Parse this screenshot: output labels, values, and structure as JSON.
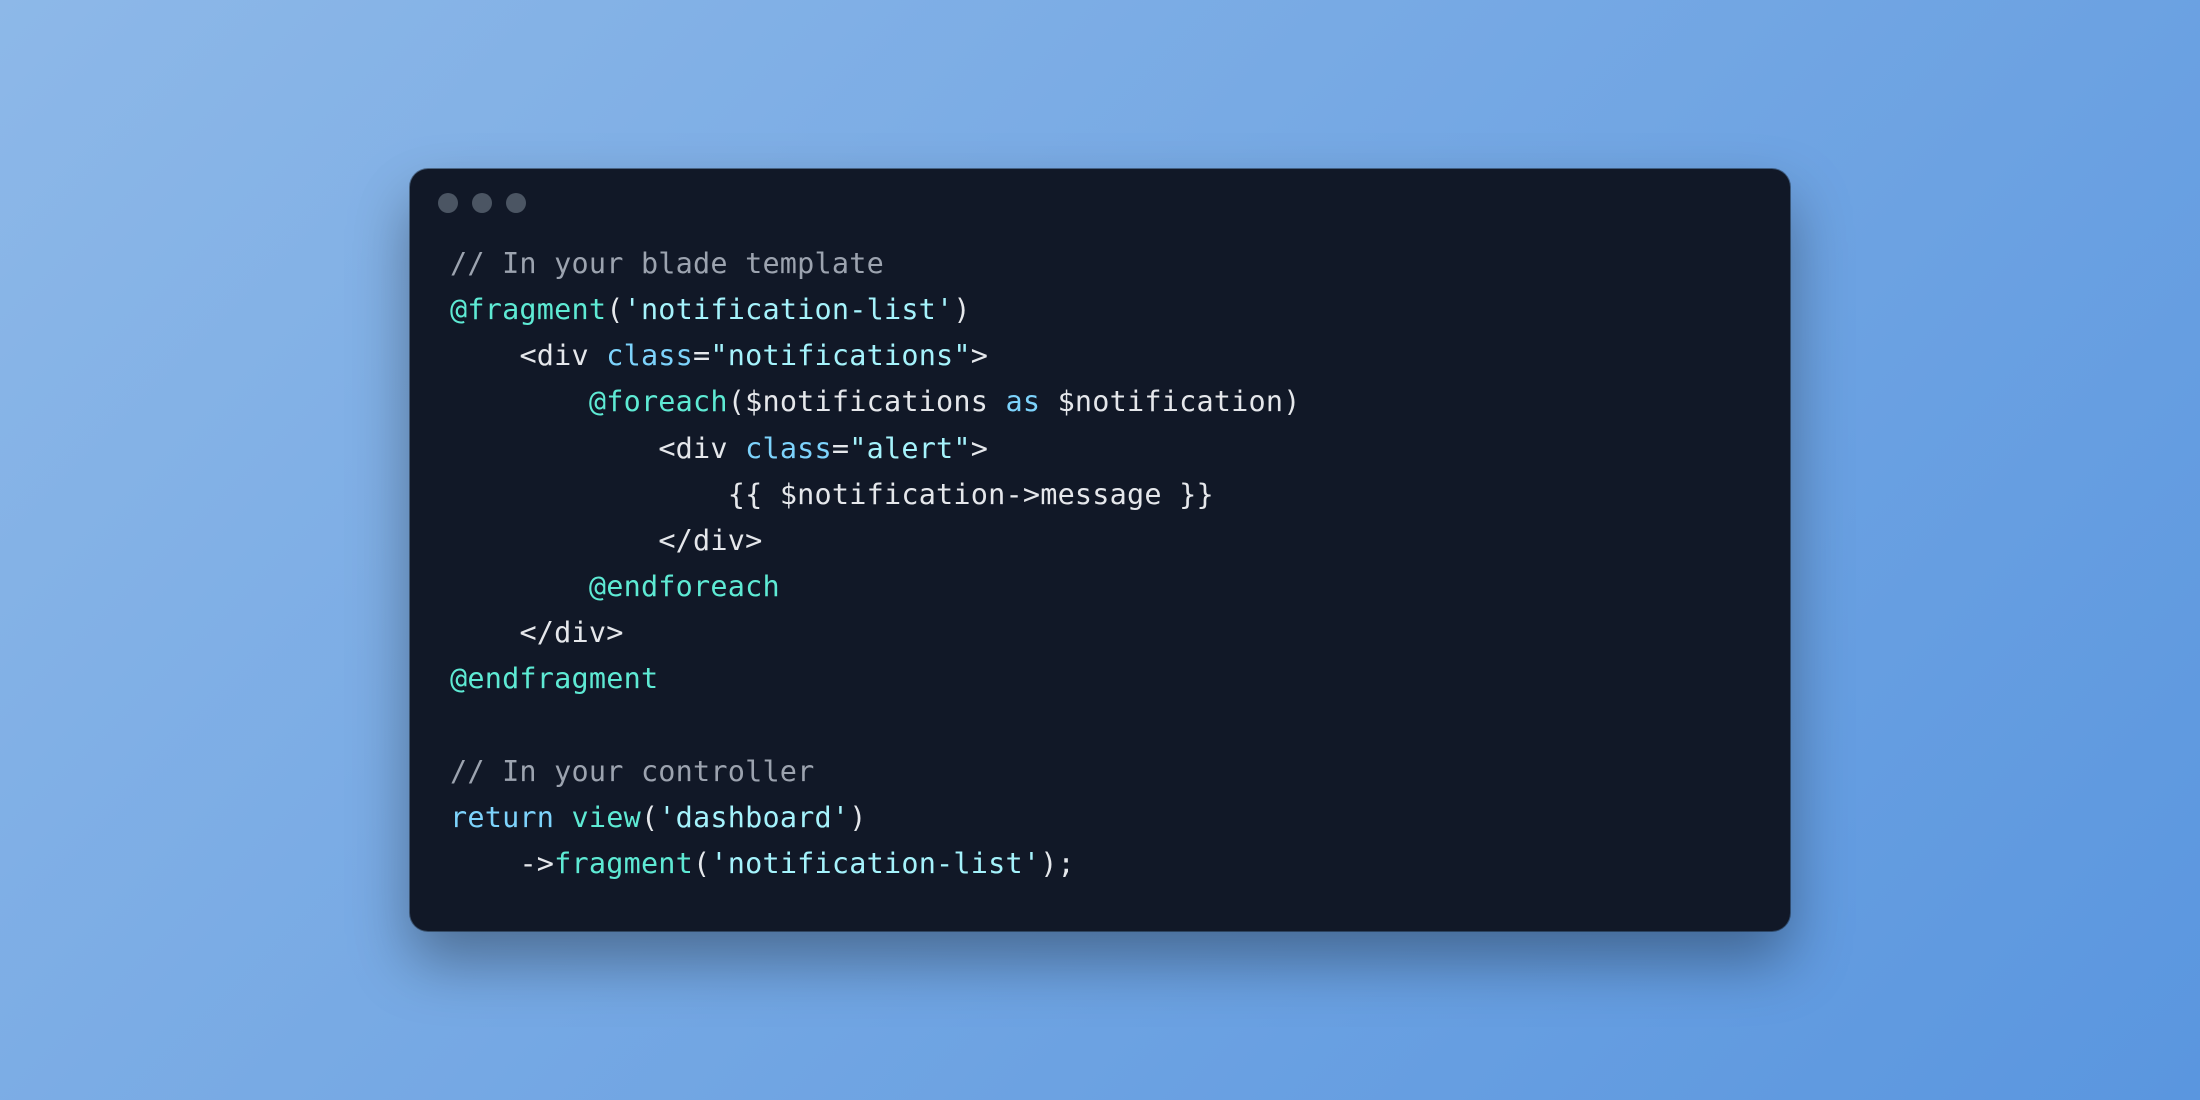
{
  "colors": {
    "bg_gradient_from": "#8db8e8",
    "bg_gradient_to": "#5a96df",
    "window_bg": "#111827",
    "dot": "#4b5563",
    "comment": "#9ca3af",
    "directive": "#5eead4",
    "string": "#a5f3fc",
    "punct": "#e5e7eb",
    "attr": "#7dd3fc",
    "plain": "#e5e7eb"
  },
  "code": {
    "comment1": "// In your blade template",
    "fragment_directive": "@fragment",
    "fragment_arg": "'notification-list'",
    "open_div1_a": "<",
    "open_div1_tag": "div",
    "open_div1_sp": " ",
    "open_div1_attr": "class",
    "open_div1_eq": "=",
    "open_div1_val": "\"notifications\"",
    "open_div1_end": ">",
    "foreach_directive": "@foreach",
    "foreach_open": "(",
    "foreach_var1": "$notifications",
    "foreach_as": " as ",
    "foreach_var2": "$notification",
    "foreach_close": ")",
    "open_div2_a": "<",
    "open_div2_tag": "div",
    "open_div2_sp": " ",
    "open_div2_attr": "class",
    "open_div2_eq": "=",
    "open_div2_val": "\"alert\"",
    "open_div2_end": ">",
    "expr_open": "{{ ",
    "expr_var": "$notification",
    "expr_arrow": "->",
    "expr_prop": "message",
    "expr_close": " }}",
    "close_div2": "</",
    "close_div2_tag": "div",
    "close_div2_end": ">",
    "endforeach": "@endforeach",
    "close_div1": "</",
    "close_div1_tag": "div",
    "close_div1_end": ">",
    "endfragment": "@endfragment",
    "blank": "",
    "comment2": "// In your controller",
    "return_kw": "return",
    "return_sp": " ",
    "view_fn": "view",
    "view_open": "(",
    "view_arg": "'dashboard'",
    "view_close": ")",
    "chain_arrow": "->",
    "fragment_fn": "fragment",
    "fragment_open": "(",
    "fragment_fn_arg": "'notification-list'",
    "fragment_close": ");"
  },
  "indent": {
    "i1": "    ",
    "i2": "        ",
    "i3": "            ",
    "i4": "                "
  }
}
